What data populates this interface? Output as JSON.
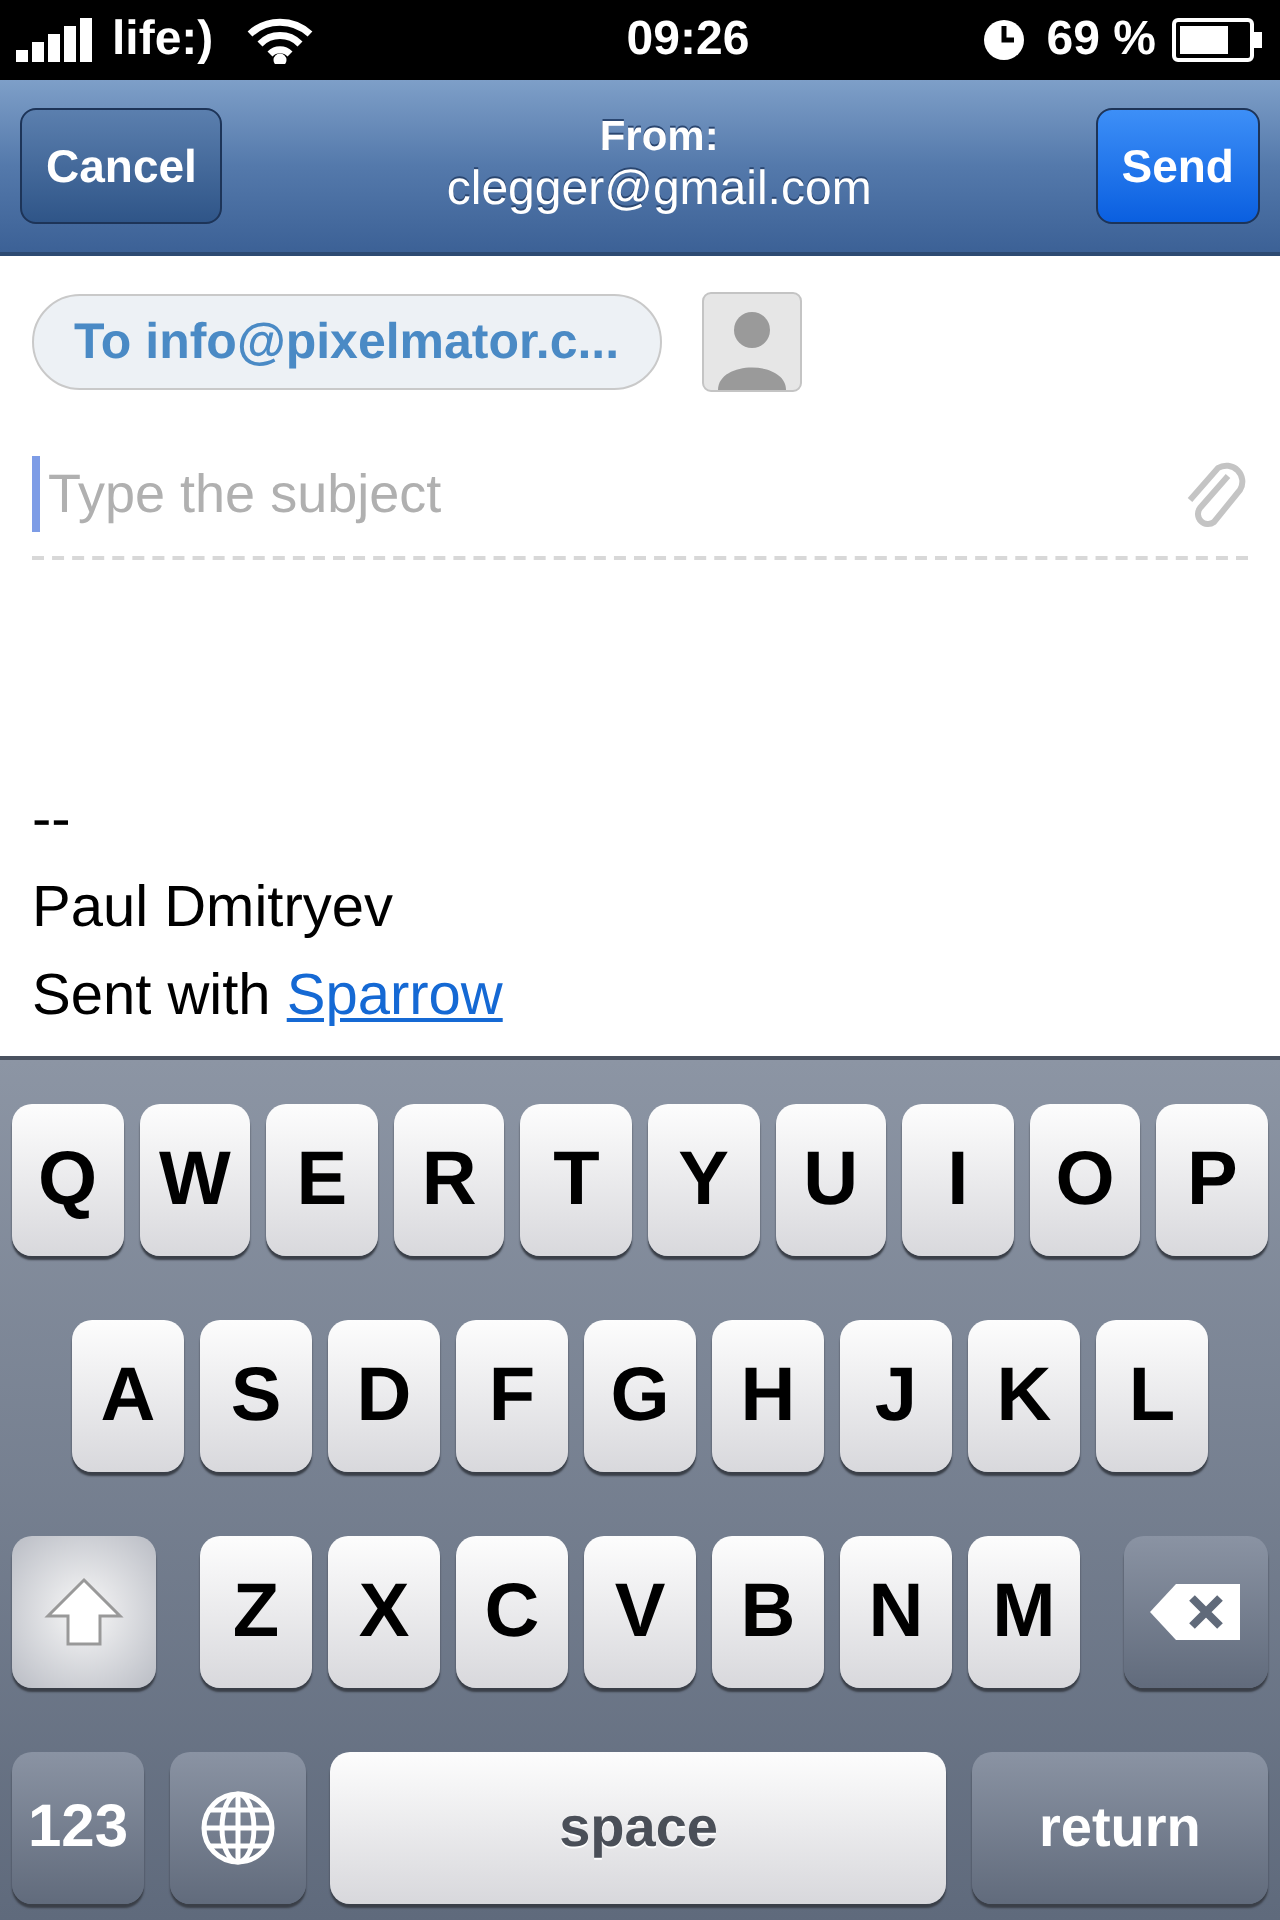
{
  "status_bar": {
    "carrier": "life:)",
    "time": "09:26",
    "battery": "69 %"
  },
  "nav_bar": {
    "cancel": "Cancel",
    "title": "From:",
    "subtitle": "clegger@gmail.com",
    "send": "Send"
  },
  "recipient": {
    "token": "To info@pixelmator.c..."
  },
  "subject": {
    "placeholder": "Type the subject"
  },
  "body": {
    "lines": [
      "--",
      "Paul Dmitryev"
    ],
    "sent_with": "Sent with",
    "link": "Sparrow"
  },
  "keyboard": {
    "top_row": [
      "Q",
      "W",
      "E",
      "R",
      "T",
      "Y",
      "U",
      "I",
      "O",
      "P"
    ],
    "middle_row": [
      "A",
      "S",
      "D",
      "F",
      "G",
      "H",
      "J",
      "K",
      "L"
    ],
    "lower_row": [
      "Z",
      "X",
      "C",
      "V",
      "B",
      "N",
      "M"
    ],
    "bottom_row": {
      "numbers_key": "123",
      "space_key": "space",
      "return_key": "return"
    }
  }
}
